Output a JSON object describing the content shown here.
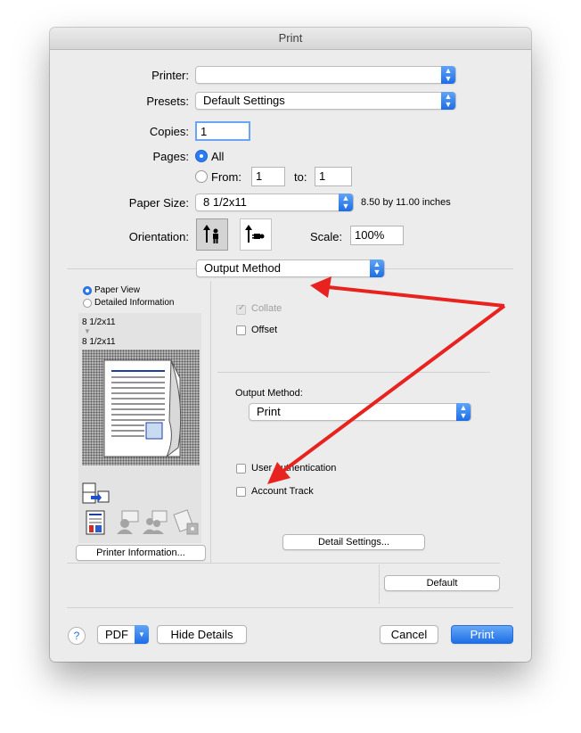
{
  "window": {
    "title": "Print"
  },
  "printer": {
    "label": "Printer:",
    "value": ""
  },
  "presets": {
    "label": "Presets:",
    "value": "Default Settings"
  },
  "copies": {
    "label": "Copies:",
    "value": "1"
  },
  "pages": {
    "label": "Pages:",
    "all": "All",
    "from": "From:",
    "from_value": "1",
    "to": "to:",
    "to_value": "1"
  },
  "paper_size": {
    "label": "Paper Size:",
    "value": "8 1/2x11",
    "dimensions": "8.50 by 11.00 inches"
  },
  "orientation": {
    "label": "Orientation:",
    "portrait_icon": "portrait-orientation-icon",
    "landscape_icon": "landscape-orientation-icon"
  },
  "scale": {
    "label": "Scale:",
    "value": "100%"
  },
  "section_popup": {
    "value": "Output Method"
  },
  "preview": {
    "paper_view": "Paper View",
    "detailed_information": "Detailed Information",
    "paper_line1": "8 1/2x11",
    "paper_line2": "8 1/2x11",
    "printer_information_button": "Printer Information..."
  },
  "options": {
    "collate": "Collate",
    "offset": "Offset",
    "output_method_label": "Output Method:",
    "output_method_value": "Print",
    "user_authentication": "User Authentication",
    "account_track": "Account Track",
    "detail_settings_button": "Detail Settings...",
    "default_button": "Default"
  },
  "footer": {
    "help": "?",
    "pdf": "PDF",
    "hide_details": "Hide Details",
    "cancel": "Cancel",
    "print": "Print"
  },
  "colors": {
    "accent": "#1e6ee6",
    "annotation_arrow": "#e8231f"
  }
}
